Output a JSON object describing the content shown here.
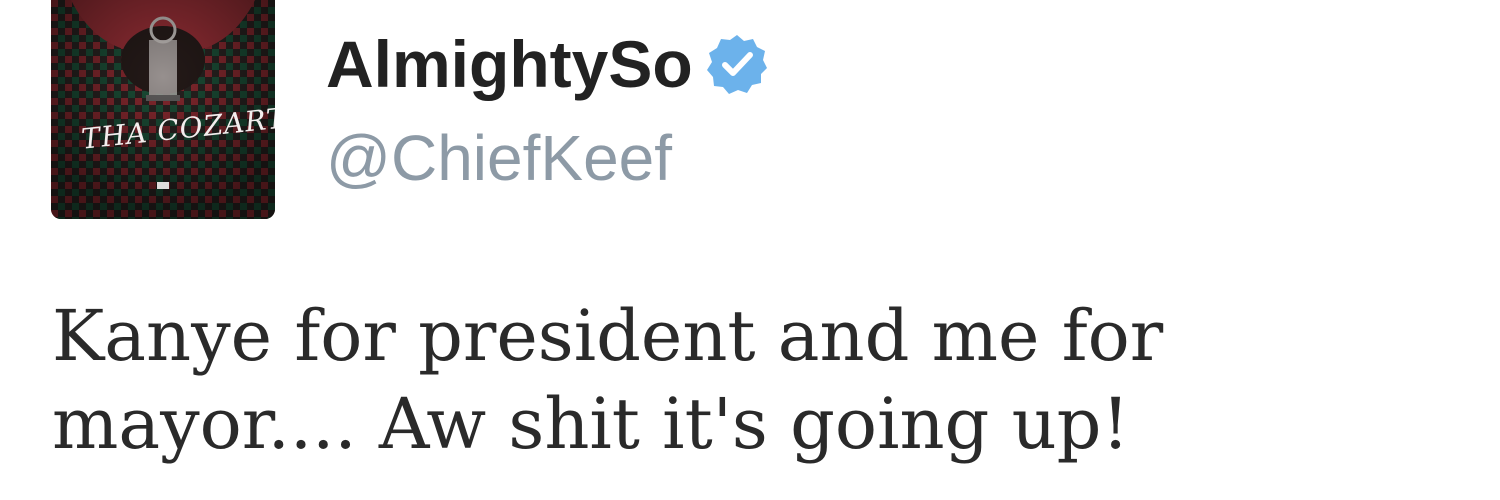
{
  "tweet": {
    "avatar": {
      "icon": "album-cover-avatar",
      "cover_text": "THA COZART"
    },
    "user": {
      "display_name": "AlmightySo",
      "handle": "@ChiefKeef",
      "verified": true,
      "verified_color": "#6cb2eb"
    },
    "text": "Kanye for president and me for mayor.... Aw shit it's going up!"
  }
}
